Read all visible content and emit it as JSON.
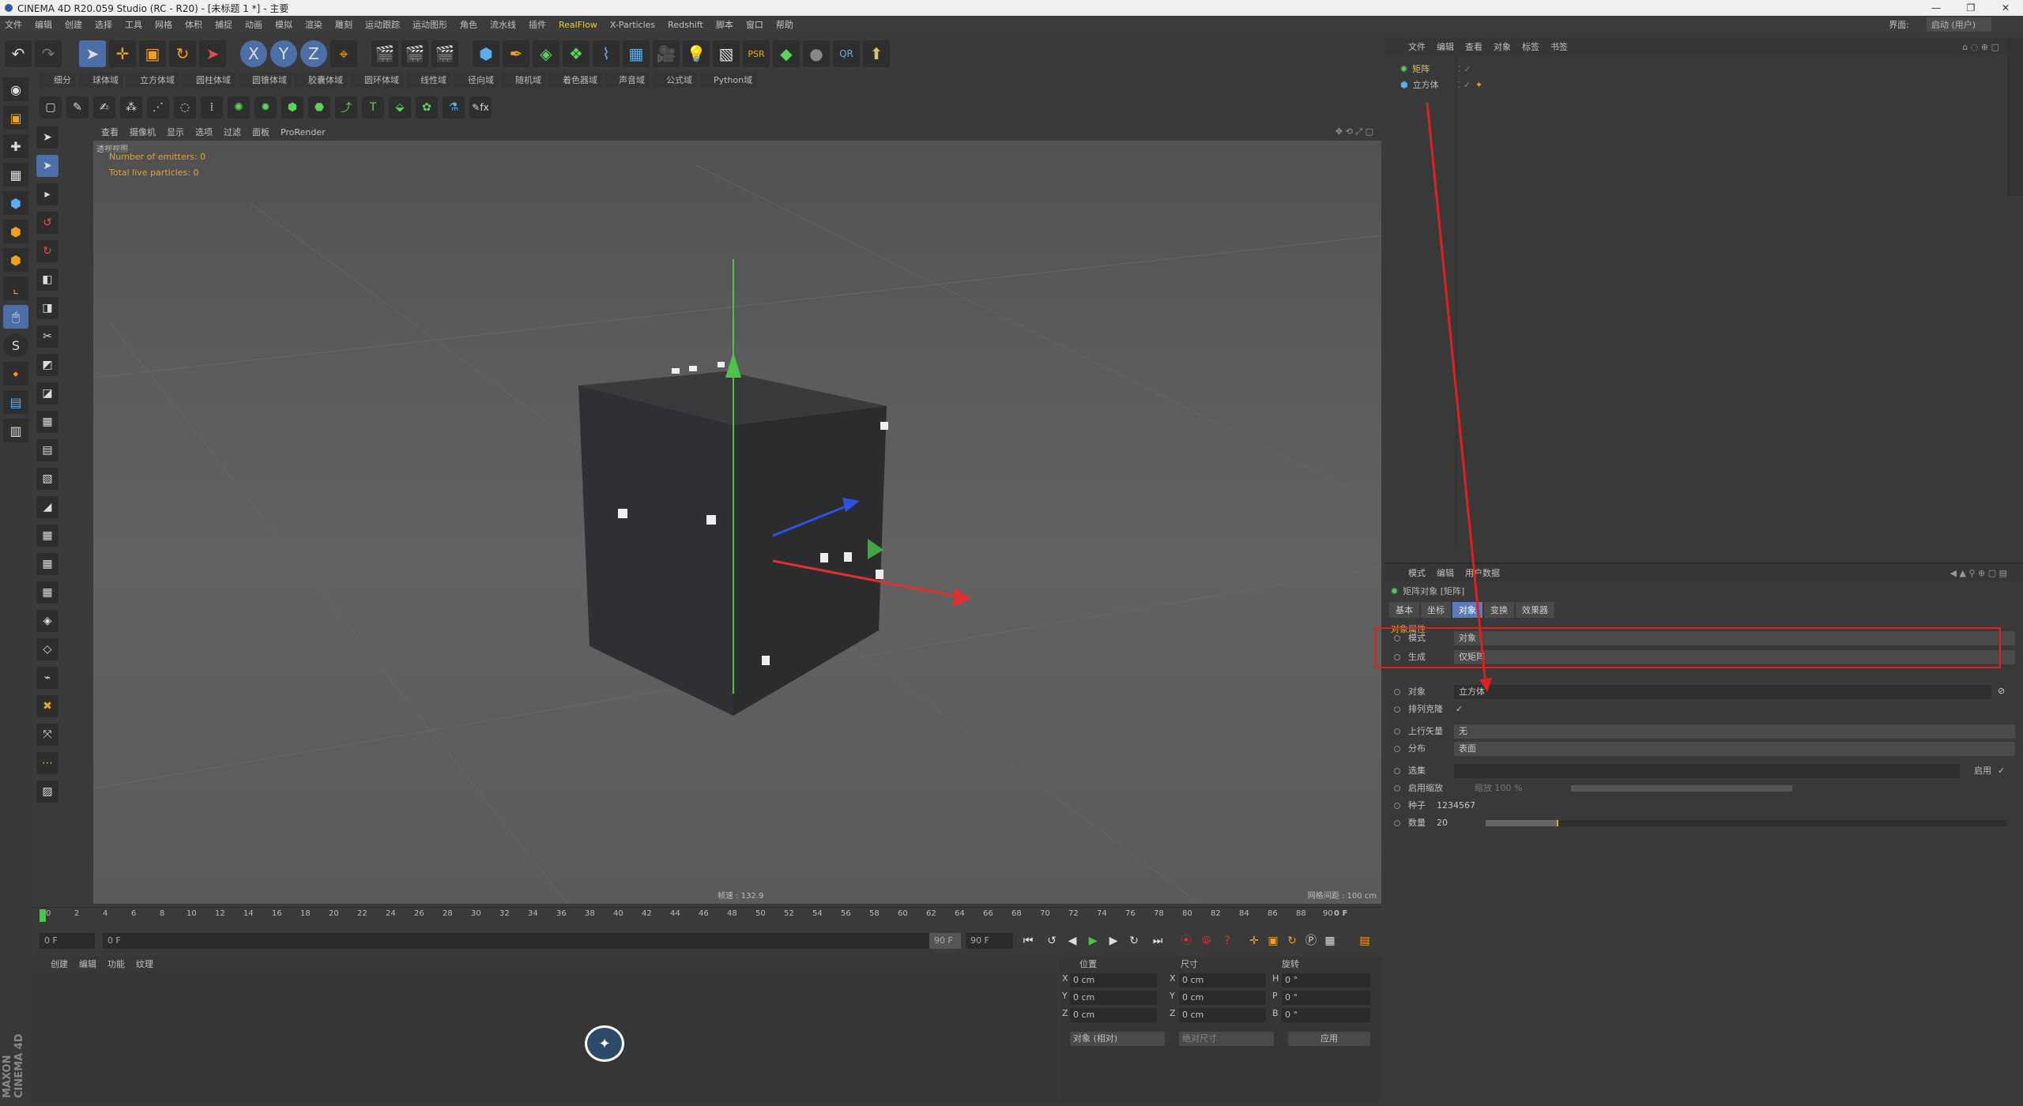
{
  "window": {
    "title": "CINEMA 4D R20.059 Studio (RC - R20) - [未标题 1 *] - 主要",
    "controls": [
      "—",
      "❐",
      "✕"
    ]
  },
  "menubar": {
    "items": [
      "文件",
      "编辑",
      "创建",
      "选择",
      "工具",
      "网格",
      "体积",
      "捕捉",
      "动画",
      "模拟",
      "渲染",
      "雕刻",
      "运动跟踪",
      "运动图形",
      "角色",
      "流水线",
      "插件",
      "RealFlow",
      "X-Particles",
      "Redshift",
      "脚本",
      "窗口",
      "帮助"
    ],
    "highlight_index": 17,
    "layout_label": "界面:",
    "layout_value": "启动 (用户)"
  },
  "toolbar2": {
    "items": [
      "细分",
      "球体域",
      "立方体域",
      "圆柱体域",
      "圆锥体域",
      "胶囊体域",
      "圆环体域",
      "线性域",
      "径向域",
      "随机域",
      "着色器域",
      "声音域",
      "公式域",
      "Python域"
    ]
  },
  "viewport": {
    "menu": [
      "查看",
      "摄像机",
      "显示",
      "选项",
      "过滤",
      "面板",
      "ProRender"
    ],
    "view_name": "透视视图",
    "hud": [
      "Number of emitters: 0",
      "Total live particles: 0"
    ],
    "bottom_center": "帧速 : 132.9",
    "bottom_right": "网格间距 : 100 cm"
  },
  "timeline": {
    "ticks": [
      "0",
      "2",
      "4",
      "6",
      "8",
      "10",
      "12",
      "14",
      "16",
      "18",
      "20",
      "22",
      "24",
      "26",
      "28",
      "30",
      "32",
      "34",
      "36",
      "38",
      "40",
      "42",
      "44",
      "46",
      "48",
      "50",
      "52",
      "54",
      "56",
      "58",
      "60",
      "62",
      "64",
      "66",
      "68",
      "70",
      "72",
      "74",
      "76",
      "78",
      "80",
      "82",
      "84",
      "86",
      "88",
      "90"
    ],
    "end_label": "0 F"
  },
  "transport": {
    "start_field": "0 F",
    "current_field": "0 F",
    "end_field": "90 F",
    "end_field2": "90 F"
  },
  "material": {
    "menu": [
      "创建",
      "编辑",
      "功能",
      "纹理"
    ]
  },
  "coords": {
    "headers": [
      "位置",
      "尺寸",
      "旋转"
    ],
    "rows": [
      {
        "axis": "X",
        "pos": "0 cm",
        "axis2": "X",
        "size": "0 cm",
        "axis3": "H",
        "rot": "0 °"
      },
      {
        "axis": "Y",
        "pos": "0 cm",
        "axis2": "Y",
        "size": "0 cm",
        "axis3": "P",
        "rot": "0 °"
      },
      {
        "axis": "Z",
        "pos": "0 cm",
        "axis2": "Z",
        "size": "0 cm",
        "axis3": "B",
        "rot": "0 °"
      }
    ],
    "mode": "对象 (相对)",
    "size_mode": "绝对尺寸",
    "apply": "应用"
  },
  "objects": {
    "menu": [
      "文件",
      "编辑",
      "查看",
      "对象",
      "标签",
      "书签"
    ],
    "items": [
      {
        "name": "矩阵",
        "color": "#d8c36a"
      },
      {
        "name": "立方体",
        "color": "#b8b8b8"
      }
    ]
  },
  "attributes": {
    "menu": [
      "模式",
      "编辑",
      "用户数据"
    ],
    "object_title": "矩阵对象 [矩阵]",
    "tabs": [
      "基本",
      "坐标",
      "对象",
      "变换",
      "效果器"
    ],
    "active_tab": 2,
    "section": "对象属性",
    "rows": [
      {
        "label": "模式",
        "value": "对象"
      },
      {
        "label": "生成",
        "value": "仅矩阵"
      },
      {
        "label": "对象",
        "value": "立方体"
      },
      {
        "label": "排列克隆",
        "value": "✓"
      },
      {
        "label": "上行矢量",
        "value": "无"
      },
      {
        "label": "分布",
        "value": "表面"
      },
      {
        "label": "选集",
        "value": ""
      },
      {
        "label": "启用缩放",
        "value": "缩放  100 %"
      },
      {
        "label": "种子",
        "value": "1234567"
      },
      {
        "label": "数量",
        "value": "20"
      }
    ],
    "enable_label": "启用"
  },
  "branding": {
    "vertical_logo": "MAXON CINEMA 4D"
  },
  "colors": {
    "accent_blue": "#5a7cb8",
    "annotation_red": "#e02020",
    "hud_text": "#d8a640",
    "realflow_menu": "#f2c33c"
  }
}
